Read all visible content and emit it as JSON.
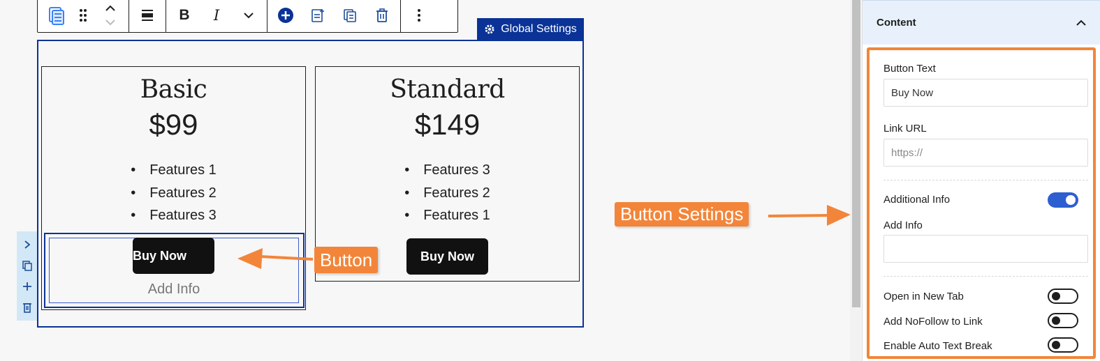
{
  "toolbar": {
    "icons": [
      "pricing-block-icon",
      "drag-handle-icon",
      "move-up-icon",
      "move-down-icon",
      "align-icon",
      "bold-icon",
      "italic-icon",
      "more-formatting-icon",
      "add-block-icon",
      "insert-after-icon",
      "duplicate-icon",
      "delete-icon",
      "options-icon"
    ],
    "bold": "B",
    "italic": "I"
  },
  "global_settings": {
    "label": "Global Settings"
  },
  "cards": [
    {
      "title": "Basic",
      "price": "$99",
      "features": [
        "Features 1",
        "Features 2",
        "Features 3"
      ],
      "button": "Buy Now",
      "add_info": "Add Info"
    },
    {
      "title": "Standard",
      "price": "$149",
      "features": [
        "Features 3",
        "Features 2",
        "Features 1"
      ],
      "button": "Buy Now"
    }
  ],
  "annotations": {
    "button": "Button",
    "button_settings": "Button Settings"
  },
  "sidebar": {
    "panel_title": "Content",
    "button_text_label": "Button Text",
    "button_text_value": "Buy Now",
    "link_url_label": "Link URL",
    "link_url_placeholder": "https://",
    "additional_info_label": "Additional Info",
    "add_info_label": "Add Info",
    "add_info_value": "",
    "open_new_tab_label": "Open in New Tab",
    "nofollow_label": "Add NoFollow to Link",
    "auto_break_label": "Enable Auto Text Break",
    "toggles": {
      "additional_info": true,
      "open_new_tab": false,
      "nofollow": false,
      "auto_break": false
    }
  },
  "colors": {
    "accent_blue": "#0a3297",
    "annotation_orange": "#f2853a",
    "toggle_on": "#2d5fd0"
  }
}
